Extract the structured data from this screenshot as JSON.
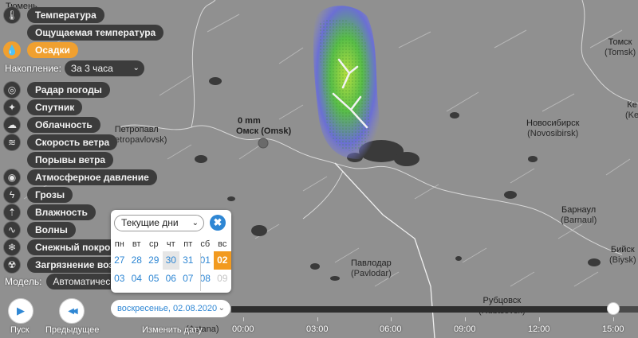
{
  "map": {
    "cities": [
      {
        "name": "Тюмень",
        "sub": ""
      },
      {
        "name": "Петропавл",
        "sub": "(Petropavlovsk)"
      },
      {
        "name": "Омск (Omsk)",
        "sub": ""
      },
      {
        "name": "Новосибирск",
        "sub": "(Novosibirsk)"
      },
      {
        "name": "Томск",
        "sub": "(Tomsk)"
      },
      {
        "name": "Барнаул",
        "sub": "(Barnaul)"
      },
      {
        "name": "Павлодар",
        "sub": "(Pavlodar)"
      },
      {
        "name": "Рубцовск",
        "sub": "(Rubtsovsk)"
      },
      {
        "name": "Бийск",
        "sub": "(Biysk)"
      },
      {
        "name": "Ке",
        "sub": "(Ke"
      },
      {
        "name": "",
        "sub": "(Astana)"
      }
    ],
    "omsk_precip": "0 mm",
    "colors": {
      "precip_low": "#6f6fd0",
      "precip_mid": "#49b845",
      "precip_high": "#a8dc3c",
      "land": "#8f8f8f",
      "water": "#3a3a3a"
    }
  },
  "layers": {
    "items": [
      {
        "label": "Температура",
        "icon": "thermometer-icon",
        "glyph": "🌡"
      },
      {
        "label": "Ощущаемая температура",
        "icon": "",
        "glyph": ""
      },
      {
        "label": "Осадки",
        "icon": "droplet-icon",
        "glyph": "💧",
        "active": true
      },
      {
        "label": "Радар погоды",
        "icon": "radar-icon",
        "glyph": "◎"
      },
      {
        "label": "Спутник",
        "icon": "satellite-icon",
        "glyph": "✦"
      },
      {
        "label": "Облачность",
        "icon": "cloud-icon",
        "glyph": "☁"
      },
      {
        "label": "Скорость ветра",
        "icon": "wind-icon",
        "glyph": "≋"
      },
      {
        "label": "Порывы ветра",
        "icon": "",
        "glyph": ""
      },
      {
        "label": "Атмосферное давление",
        "icon": "pressure-icon",
        "glyph": "◉"
      },
      {
        "label": "Грозы",
        "icon": "lightning-icon",
        "glyph": "ϟ"
      },
      {
        "label": "Влажность",
        "icon": "humidity-icon",
        "glyph": "⇡"
      },
      {
        "label": "Волны",
        "icon": "waves-icon",
        "glyph": "∿"
      },
      {
        "label": "Снежный покров",
        "icon": "snowflake-icon",
        "glyph": "❄"
      },
      {
        "label": "Загрязнение возд",
        "icon": "pollution-icon",
        "glyph": "☢"
      }
    ],
    "accumulation_label": "Накопление:",
    "accumulation_value": "За 3 часа",
    "model_label": "Модель:",
    "model_value": "Автоматическая"
  },
  "calendar": {
    "mode": "Текущие дни",
    "close_glyph": "✖",
    "weekdays": [
      "пн",
      "вт",
      "ср",
      "чт",
      "пт",
      "сб",
      "вс"
    ],
    "weeks": [
      [
        "27",
        "28",
        "29",
        "30",
        "31",
        "01",
        "02"
      ],
      [
        "03",
        "04",
        "05",
        "06",
        "07",
        "08",
        "09"
      ]
    ]
  },
  "controls": {
    "play_label": "Пуск",
    "prev_label": "Предыдущее",
    "change_date_label": "Изменить дату",
    "date_value": "воскресенье, 02.08.2020",
    "play_glyph": "▶",
    "prev_glyph": "◀◀"
  },
  "timeline": {
    "ticks": [
      "00:00",
      "03:00",
      "06:00",
      "09:00",
      "12:00",
      "15:00"
    ],
    "progress": 0.94
  }
}
